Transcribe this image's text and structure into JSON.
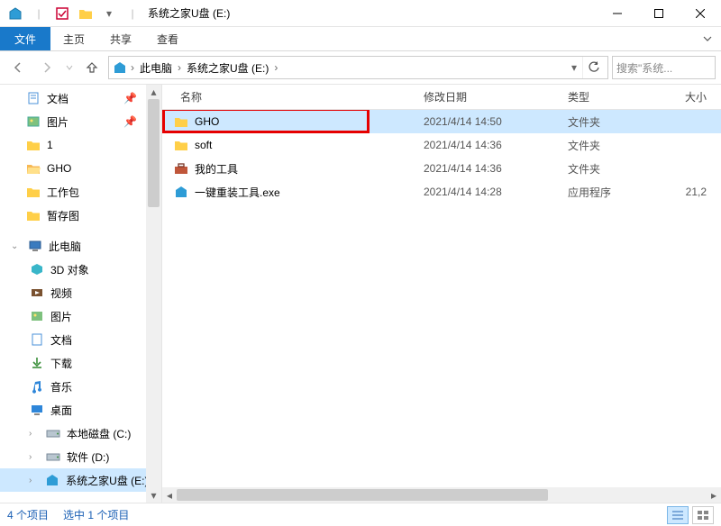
{
  "window": {
    "title": "系统之家U盘 (E:)"
  },
  "ribbon": {
    "file": "文件",
    "tabs": [
      "主页",
      "共享",
      "查看"
    ]
  },
  "breadcrumb": {
    "items": [
      "此电脑",
      "系统之家U盘 (E:)"
    ]
  },
  "search": {
    "placeholder": "搜索\"系统..."
  },
  "sidebar": {
    "pinned": [
      {
        "label": "文档",
        "icon": "document-icon",
        "pinned": true
      },
      {
        "label": "图片",
        "icon": "pictures-icon",
        "pinned": true
      },
      {
        "label": "1",
        "icon": "folder-icon",
        "pinned": false
      },
      {
        "label": "GHO",
        "icon": "folder-open-icon",
        "pinned": false
      },
      {
        "label": "工作包",
        "icon": "folder-icon",
        "pinned": false
      },
      {
        "label": "暂存图",
        "icon": "folder-icon",
        "pinned": false
      }
    ],
    "this_pc_label": "此电脑",
    "this_pc_children": [
      {
        "label": "3D 对象",
        "icon": "objects3d-icon"
      },
      {
        "label": "视频",
        "icon": "video-icon"
      },
      {
        "label": "图片",
        "icon": "pictures-icon"
      },
      {
        "label": "文档",
        "icon": "document-icon"
      },
      {
        "label": "下载",
        "icon": "download-icon"
      },
      {
        "label": "音乐",
        "icon": "music-icon"
      },
      {
        "label": "桌面",
        "icon": "desktop-icon"
      },
      {
        "label": "本地磁盘 (C:)",
        "icon": "drive-icon"
      },
      {
        "label": "软件 (D:)",
        "icon": "drive-icon"
      },
      {
        "label": "系统之家U盘 (E:)",
        "icon": "usb-icon",
        "selected": true
      }
    ]
  },
  "columns": {
    "name": "名称",
    "date": "修改日期",
    "type": "类型",
    "size": "大小"
  },
  "files": [
    {
      "name": "GHO",
      "date": "2021/4/14 14:50",
      "type": "文件夹",
      "size": "",
      "icon": "folder",
      "selected": true,
      "highlight": true
    },
    {
      "name": "soft",
      "date": "2021/4/14 14:36",
      "type": "文件夹",
      "size": "",
      "icon": "folder"
    },
    {
      "name": "我的工具",
      "date": "2021/4/14 14:36",
      "type": "文件夹",
      "size": "",
      "icon": "toolbox"
    },
    {
      "name": "一键重装工具.exe",
      "date": "2021/4/14 14:28",
      "type": "应用程序",
      "size": "21,2",
      "icon": "app"
    }
  ],
  "status": {
    "count": "4 个项目",
    "selected": "选中 1 个项目"
  }
}
